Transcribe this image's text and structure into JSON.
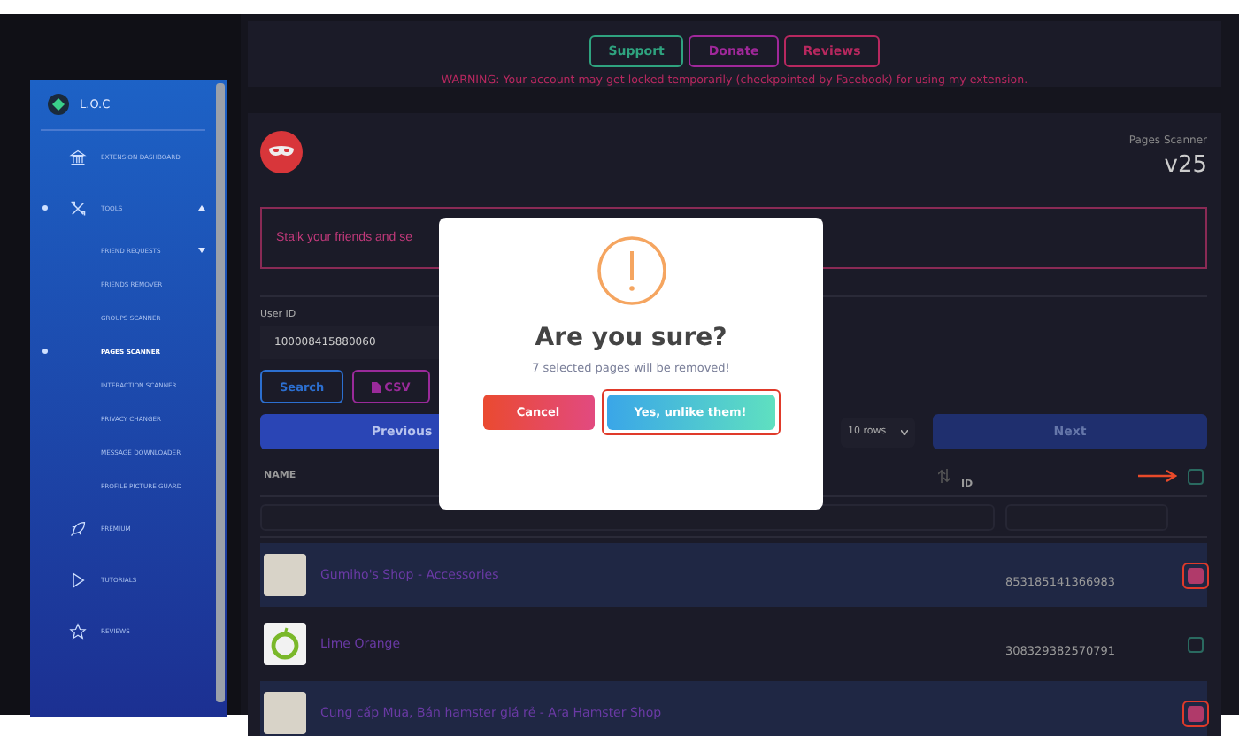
{
  "top_panel": {
    "buttons": [
      {
        "label": "Support",
        "color": "#2fa37f"
      },
      {
        "label": "Donate",
        "color": "#a0289a"
      },
      {
        "label": "Reviews",
        "color": "#b8285f"
      }
    ],
    "warning": "WARNING: Your account may get locked temporarily (checkpointed by Facebook) for using my extension."
  },
  "sidebar": {
    "brand": "L.O.C",
    "items": [
      {
        "label": "EXTENSION DASHBOARD",
        "kind": "dashboard",
        "selected": false
      },
      {
        "label": "TOOLS",
        "kind": "tools",
        "selected": true,
        "expanded": true,
        "children": [
          {
            "label": "FRIEND REQUESTS",
            "selected": false,
            "expanded": false
          },
          {
            "label": "FRIENDS REMOVER",
            "selected": false
          },
          {
            "label": "GROUPS SCANNER",
            "selected": false
          },
          {
            "label": "PAGES SCANNER",
            "selected": true
          },
          {
            "label": "INTERACTION SCANNER",
            "selected": false
          },
          {
            "label": "PRIVACY CHANGER",
            "selected": false
          },
          {
            "label": "MESSAGE DOWNLOADER",
            "selected": false
          },
          {
            "label": "PROFILE PICTURE GUARD",
            "selected": false
          }
        ]
      },
      {
        "label": "PREMIUM",
        "kind": "premium",
        "selected": false
      },
      {
        "label": "TUTORIALS",
        "kind": "tutorials",
        "selected": false
      },
      {
        "label": "REVIEWS",
        "kind": "reviews",
        "selected": false
      }
    ]
  },
  "header": {
    "title": "Pages Scanner",
    "version": "v25"
  },
  "notice": "Stalk your friends and se",
  "user_id": {
    "label": "User ID",
    "value": "100008415880060"
  },
  "actions": [
    {
      "label": "Search",
      "kind": "search",
      "color": "#2c6fd0"
    },
    {
      "label": "CSV",
      "kind": "csv",
      "color": "#9a2a9a"
    }
  ],
  "pagination": {
    "previous": "Previous",
    "rows": "10 rows",
    "next": "Next"
  },
  "table": {
    "columns": [
      "NAME",
      "ID"
    ],
    "rows": [
      {
        "name": "Gumiho's Shop - Accessories",
        "id": "853185141366983",
        "kind": "photo",
        "selected": true
      },
      {
        "name": "Lime Orange",
        "id": "308329382570791",
        "kind": "logo",
        "selected": false
      },
      {
        "name": "Cung cấp Mua, Bán hamster giá rẻ - Ara Hamster Shop",
        "kind": "photo",
        "selected": true
      }
    ],
    "all_selected": false
  },
  "modal": {
    "title": "Are you sure?",
    "message": "7 selected pages will be removed!",
    "cancel": "Cancel",
    "confirm": "Yes, unlike them!"
  }
}
